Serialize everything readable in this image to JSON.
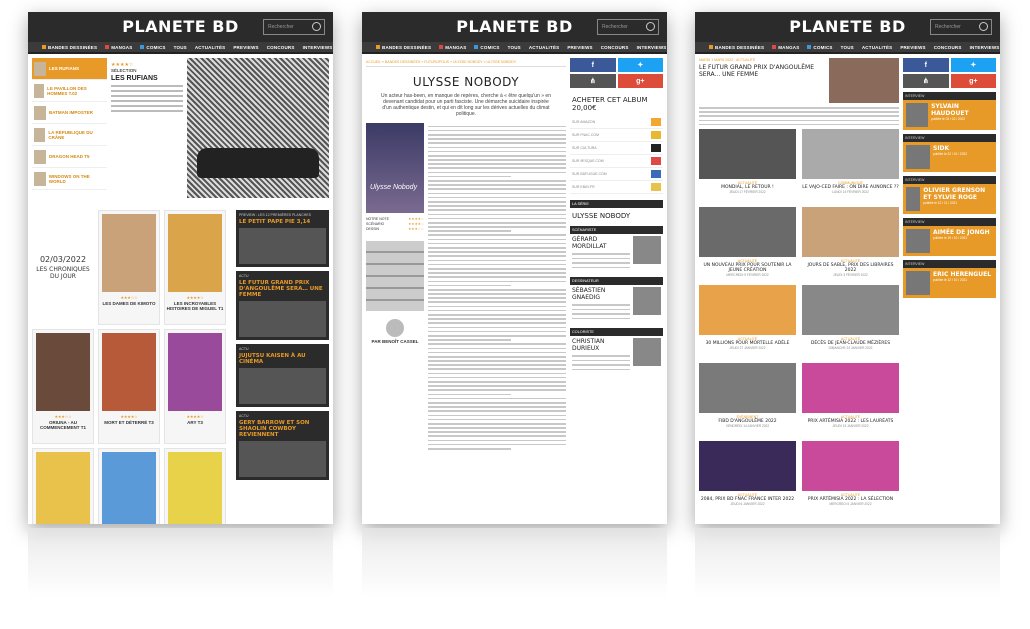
{
  "site": {
    "logo": "PLANETE BD",
    "search_placeholder": "Rechercher",
    "nav": [
      {
        "label": "BANDES DESSINÉES",
        "color": "#e89a28"
      },
      {
        "label": "MANGAS",
        "color": "#e04848"
      },
      {
        "label": "COMICS",
        "color": "#3a9ad9"
      },
      {
        "label": "TOUS",
        "color": ""
      },
      {
        "label": "ACTUALITÉS",
        "color": ""
      },
      {
        "label": "PREVIEWS",
        "color": ""
      },
      {
        "label": "CONCOURS",
        "color": ""
      },
      {
        "label": "INTERVIEWS",
        "color": ""
      }
    ]
  },
  "page1": {
    "list": [
      {
        "label": "LES RUFIANS",
        "active": true
      },
      {
        "label": "LE PAVILLON DES HOMMES T.02",
        "active": false
      },
      {
        "label": "BATMAN IMPOSTER",
        "active": false
      },
      {
        "label": "LA RÉPUBLIQUE DU CRÂNE",
        "active": false
      },
      {
        "label": "DRAGON HEAD T5",
        "active": false
      },
      {
        "label": "WINDOWS ON THE WORLD",
        "active": false
      }
    ],
    "feature": {
      "stars": "★★★★☆",
      "kicker": "SÉLECTION",
      "title": "LES RUFIANS"
    },
    "chronique": {
      "date": "02/03/2022",
      "label": "LES CHRONIQUES DU JOUR"
    },
    "cards": [
      {
        "meta": "★★★☆☆",
        "name": "LES DAMES DE KIMOTO",
        "color": "#c9a27a"
      },
      {
        "meta": "★★★★☆",
        "name": "LES INCROYABLES HISTOIRES DE MIGUEL T1",
        "color": "#d9a44a"
      },
      {
        "meta": "★★★☆☆",
        "name": "ORIUNA - AU COMMENCEMENT T1",
        "color": "#6a4a3a"
      },
      {
        "meta": "★★★★☆",
        "name": "MORT ET DÉTERRÉ T3",
        "color": "#b75a3a"
      },
      {
        "meta": "★★★★☆",
        "name": "ARY T3",
        "color": "#9a4a9a"
      },
      {
        "meta": "",
        "name": "",
        "color": "#e8c24a"
      },
      {
        "meta": "",
        "name": "",
        "color": "#5a9ad9"
      },
      {
        "meta": "",
        "name": "",
        "color": "#e8d24a"
      }
    ],
    "side": [
      {
        "kicker": "PREVIEW : LES 12 PREMIÈRES PLANCHES",
        "head": "LE PETIT PAPE PIE 3,14"
      },
      {
        "kicker": "ACTU",
        "head": "LE FUTUR GRAND PRIX D'ANGOULÊME SERA… UNE FEMME"
      },
      {
        "kicker": "ACTU",
        "head": "JUJUTSU KAISEN À AU CINÉMA"
      },
      {
        "kicker": "ACTU",
        "head": "GERY BARROW ET SON SHAOLIN COWBOY REVIENNENT"
      }
    ]
  },
  "page2": {
    "crumb": "ACCUEIL » BANDES DESSINÉES » FUTUROPOLIS » ULYSSE NOBODY » ULYSSE NOBODY",
    "title": "ULYSSE NOBODY",
    "chapo": "Un acteur has-been, en manque de repères, cherche à « être quelqu'un » en devenant candidat pour un parti fasciste. Une démarche suicidaire inspirée d'un authentique destin, et qui en dit long sur les dérives actuelles du climat politique.",
    "cover_title": "Ulysse Nobody",
    "notes": [
      {
        "k": "NOTRE NOTE",
        "v": "★★★★☆"
      },
      {
        "k": "SCÉNARIO",
        "v": "★★★★☆"
      },
      {
        "k": "DESSIN",
        "v": "★★★☆☆"
      }
    ],
    "author": "PAR BENOÎT CASSEL",
    "buy_title": "ACHETER CET ALBUM 20,00€",
    "buy_rows": [
      "SUR AMAZON",
      "SUR FNAC.COM",
      "SUR CULTURA",
      "SUR 9ESQUE.COM",
      "SUR BDFUGUE.COM",
      "SUR EBAY.FR"
    ],
    "series_head": "LA SÉRIE",
    "series_title": "ULYSSE NOBODY",
    "people": [
      {
        "role": "SCÉNARISTE",
        "name": "GÉRARD MORDILLAT"
      },
      {
        "role": "DESSINATEUR",
        "name": "SÉBASTIEN GNAEDIG"
      },
      {
        "role": "COLORISTE",
        "name": "CHRISTIAN DURIEUX"
      }
    ]
  },
  "page3": {
    "hero": {
      "kicker": "MARDI 1 MARS 2022 - ACTUALITÉ",
      "head": "LE FUTUR GRAND PRIX D'ANGOULÊME SERA... UNE FEMME"
    },
    "news": [
      {
        "cat": "ACTUALITÉ",
        "title": "MONDIAL, LE RETOUR !",
        "date": "JEUDI 17 FÉVRIER 2022",
        "color": "#555555"
      },
      {
        "cat": "COMMUNIQUÉ",
        "title": "LE VAJO-CED FAIRE : ON DIRE AUNONCE ??",
        "date": "LUNDI 14 FÉVRIER 2022",
        "color": "#aaaaaa"
      },
      {
        "cat": "ACTUALITÉ",
        "title": "UN NOUVEAU PRIX POUR SOUTENIR LA JEUNE CRÉATION",
        "date": "MERCREDI 9 FÉVRIER 2022",
        "color": "#6a6a6a"
      },
      {
        "cat": "ACTUALITÉ",
        "title": "JOURS DE SABLE, PRIX DES LIBRAIRES 2022",
        "date": "JEUDI 3 FÉVRIER 2022",
        "color": "#c9a27a"
      },
      {
        "cat": "ACTUALITÉ",
        "title": "30 MILLIONS POUR MORTELLE ADÈLE",
        "date": "JEUDI 27 JANVIER 2022",
        "color": "#e8a24a"
      },
      {
        "cat": "ACTUALITÉ",
        "title": "DÉCÈS DE JEAN-CLAUDE MÉZIÈRES",
        "date": "DIMANCHE 23 JANVIER 2022",
        "color": "#888888"
      },
      {
        "cat": "ÉVÉNEMENT",
        "title": "FIBD D'ANGOULÊME 2022",
        "date": "VENDREDI 14 JANVIER 2022",
        "color": "#7a7a7a"
      },
      {
        "cat": "ACTUALITÉ",
        "title": "PRIX ARTÉMISIA 2022 : LES LAURÉATS",
        "date": "JEUDI 13 JANVIER 2022",
        "color": "#c94a9a"
      },
      {
        "cat": "ACTUALITÉ",
        "title": "2084, PRIX BD FNAC FRANCE INTER 2022",
        "date": "JEUDI 6 JANVIER 2022",
        "color": "#3a2a5a"
      },
      {
        "cat": "ACTUALITÉ",
        "title": "PRIX ARTÉMISIA 2022 : LA SÉLECTION",
        "date": "MERCREDI 5 JANVIER 2022",
        "color": "#c94a9a"
      }
    ],
    "interviews": [
      {
        "name": "SYLVAIN HAUDOUET",
        "sub": "publiée le 03 / 02 / 2022"
      },
      {
        "name": "SIDK",
        "sub": "publiée le 22 / 01 / 2022"
      },
      {
        "name": "OLIVIER GRENSON ET SYLVIE ROGE",
        "sub": "publiée le 12 / 11 / 2021"
      },
      {
        "name": "AIMÉE DE JONGH",
        "sub": "publiée le 19 / 10 / 2021"
      },
      {
        "name": "ERIC HERENGUEL",
        "sub": "publiée le 12 / 10 / 2021"
      }
    ],
    "interview_kicker": "INTERVIEW"
  }
}
